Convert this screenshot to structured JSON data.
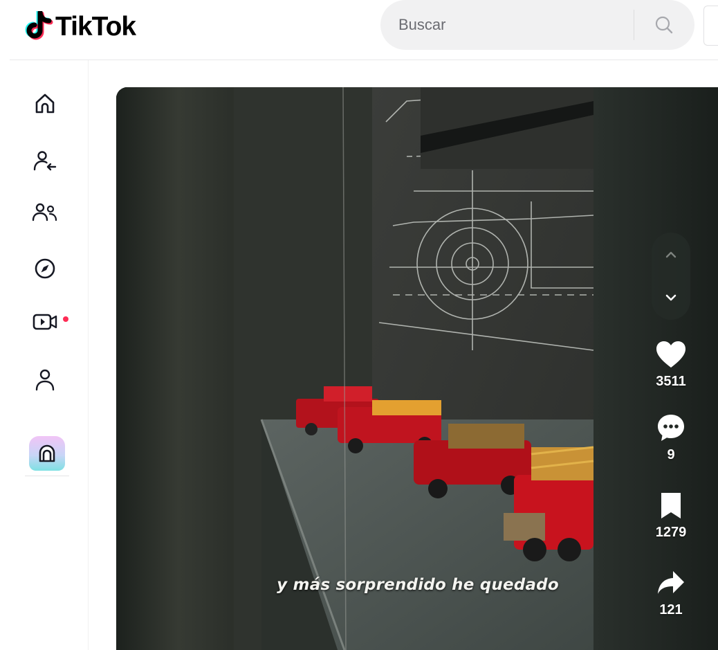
{
  "app": {
    "logo_text": "TikTok",
    "brand_colors": {
      "cyan": "#25F4EE",
      "red": "#FE2C55",
      "black": "#000000"
    }
  },
  "search": {
    "placeholder": "Buscar",
    "icon": "search-icon"
  },
  "sidebar": {
    "items": [
      {
        "name": "home",
        "icon": "home-icon"
      },
      {
        "name": "following",
        "icon": "following-icon"
      },
      {
        "name": "friends",
        "icon": "friends-icon"
      },
      {
        "name": "explore",
        "icon": "compass-icon",
        "notification_dot": true
      },
      {
        "name": "live",
        "icon": "live-video-icon"
      },
      {
        "name": "profile",
        "icon": "profile-icon"
      }
    ],
    "coins_icon": "coins-icon",
    "notification_color": "#FE2C55"
  },
  "video": {
    "caption": "y más sorprendido he quedado",
    "nav": {
      "up_icon": "chevron-up-icon",
      "down_icon": "chevron-down-icon"
    },
    "actions": {
      "likes": {
        "icon": "heart-icon",
        "count": "3511"
      },
      "comments": {
        "icon": "comment-icon",
        "count": "9"
      },
      "saves": {
        "icon": "bookmark-icon",
        "count": "1279"
      },
      "shares": {
        "icon": "share-icon",
        "count": "121"
      }
    }
  }
}
